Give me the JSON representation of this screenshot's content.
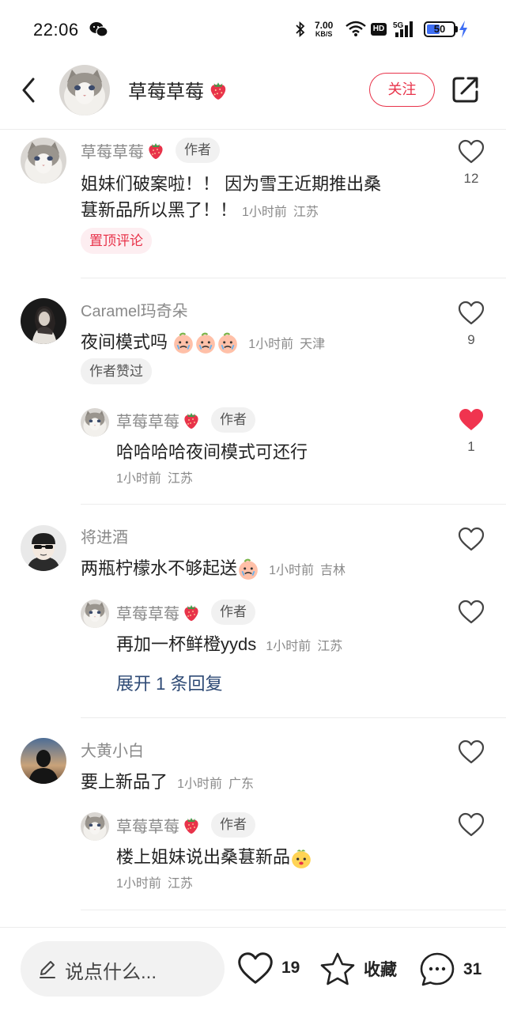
{
  "status_bar": {
    "time": "22:06",
    "net_speed_value": "7.00",
    "net_speed_unit": "KB/S",
    "hd_label": "HD",
    "network": "5G",
    "battery": "50",
    "battery_level": 0.5
  },
  "header": {
    "name": "草莓草莓",
    "follow_label": "关注"
  },
  "comments": [
    {
      "user": "草莓草莓",
      "author_tag": "作者",
      "text_line1": "姐妹们破案啦！！ 因为雪王近期推出桑",
      "text_line2": "葚新品所以黑了！！",
      "time": "1小时前",
      "location": "江苏",
      "pinned_label": "置顶评论",
      "likes": "12"
    },
    {
      "user": "Caramel玛奇朵",
      "text": "夜间模式吗",
      "time": "1小时前",
      "location": "天津",
      "author_liked_label": "作者赞过",
      "likes": "9",
      "reply": {
        "user": "草莓草莓",
        "author_tag": "作者",
        "text": "哈哈哈哈夜间模式可还行",
        "time": "1小时前",
        "location": "江苏",
        "likes": "1"
      }
    },
    {
      "user": "将进酒",
      "text": "两瓶柠檬水不够起送",
      "time": "1小时前",
      "location": "吉林",
      "reply": {
        "user": "草莓草莓",
        "author_tag": "作者",
        "text": "再加一杯鲜橙yyds",
        "time": "1小时前",
        "location": "江苏"
      },
      "expand_label": "展开 1 条回复"
    },
    {
      "user": "大黄小白",
      "text": "要上新品了",
      "time": "1小时前",
      "location": "广东",
      "reply": {
        "user": "草莓草莓",
        "author_tag": "作者",
        "text": "楼上姐妹说出桑葚新品",
        "time": "1小时前",
        "location": "江苏"
      }
    }
  ],
  "bottom_bar": {
    "input_placeholder": "说点什么...",
    "likes": "19",
    "favorite_label": "收藏",
    "comments": "31"
  },
  "colors": {
    "accent_red": "#e8334a",
    "link_blue": "#2e4a75",
    "battery_blue": "#3e6ef4"
  }
}
